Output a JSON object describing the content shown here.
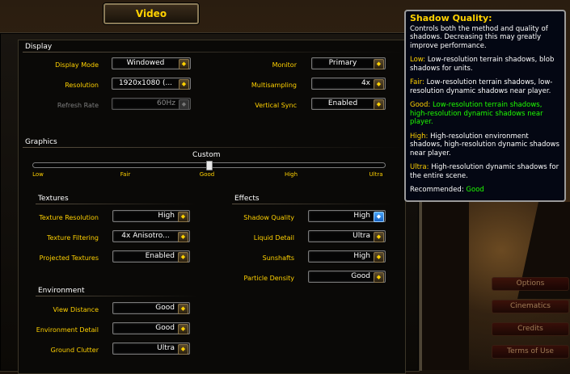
{
  "window_tab": {
    "title": "Video"
  },
  "display": {
    "heading": "Display",
    "display_mode": {
      "label": "Display Mode",
      "value": "Windowed"
    },
    "resolution": {
      "label": "Resolution",
      "value": "1920x1080 (..."
    },
    "refresh_rate": {
      "label": "Refresh Rate",
      "value": "60Hz"
    },
    "monitor": {
      "label": "Monitor",
      "value": "Primary"
    },
    "multisampling": {
      "label": "Multisampling",
      "value": "4x"
    },
    "vertical_sync": {
      "label": "Vertical Sync",
      "value": "Enabled"
    }
  },
  "graphics": {
    "heading": "Graphics",
    "preset_label": "Custom",
    "preset_level": 0.5,
    "ticks": [
      "Low",
      "Fair",
      "Good",
      "High",
      "Ultra"
    ]
  },
  "textures": {
    "heading": "Textures",
    "texture_resolution": {
      "label": "Texture Resolution",
      "value": "High"
    },
    "texture_filtering": {
      "label": "Texture Filtering",
      "value": "4x Anisotro..."
    },
    "projected_textures": {
      "label": "Projected Textures",
      "value": "Enabled"
    }
  },
  "environment": {
    "heading": "Environment",
    "view_distance": {
      "label": "View Distance",
      "value": "Good"
    },
    "environment_detail": {
      "label": "Environment Detail",
      "value": "Good"
    },
    "ground_clutter": {
      "label": "Ground Clutter",
      "value": "Ultra"
    }
  },
  "effects": {
    "heading": "Effects",
    "shadow_quality": {
      "label": "Shadow Quality",
      "value": "High"
    },
    "liquid_detail": {
      "label": "Liquid Detail",
      "value": "Ultra"
    },
    "sunshafts": {
      "label": "Sunshafts",
      "value": "High"
    },
    "particle_density": {
      "label": "Particle Density",
      "value": "Good"
    }
  },
  "tooltip": {
    "title": "Shadow Quality:",
    "description": "Controls both the method and quality of shadows. Decreasing this may greatly improve performance.",
    "low_key": "Low:",
    "low_text": "Low-resolution terrain shadows, blob shadows for units.",
    "fair_key": "Fair:",
    "fair_text": "Low-resolution terrain shadows, low-resolution dynamic shadows near player.",
    "good_key": "Good:",
    "good_text": "Low-resolution terrain shadows, high-resolution dynamic shadows near player.",
    "high_key": "High:",
    "high_text": "High-resolution environment shadows, high-resolution dynamic shadows near player.",
    "ultra_key": "Ultra:",
    "ultra_text": "High-resolution dynamic shadows for the entire scene.",
    "recommended_key": "Recommended:",
    "recommended_value": "Good"
  },
  "side_menu": [
    "Options",
    "Cinematics",
    "Credits",
    "Terms of Use"
  ],
  "icons": {
    "dropdown": "dropdown-arrow-icon"
  },
  "colors": {
    "gold": "#ffd100",
    "green": "#1eff00",
    "white": "#ffffff"
  }
}
